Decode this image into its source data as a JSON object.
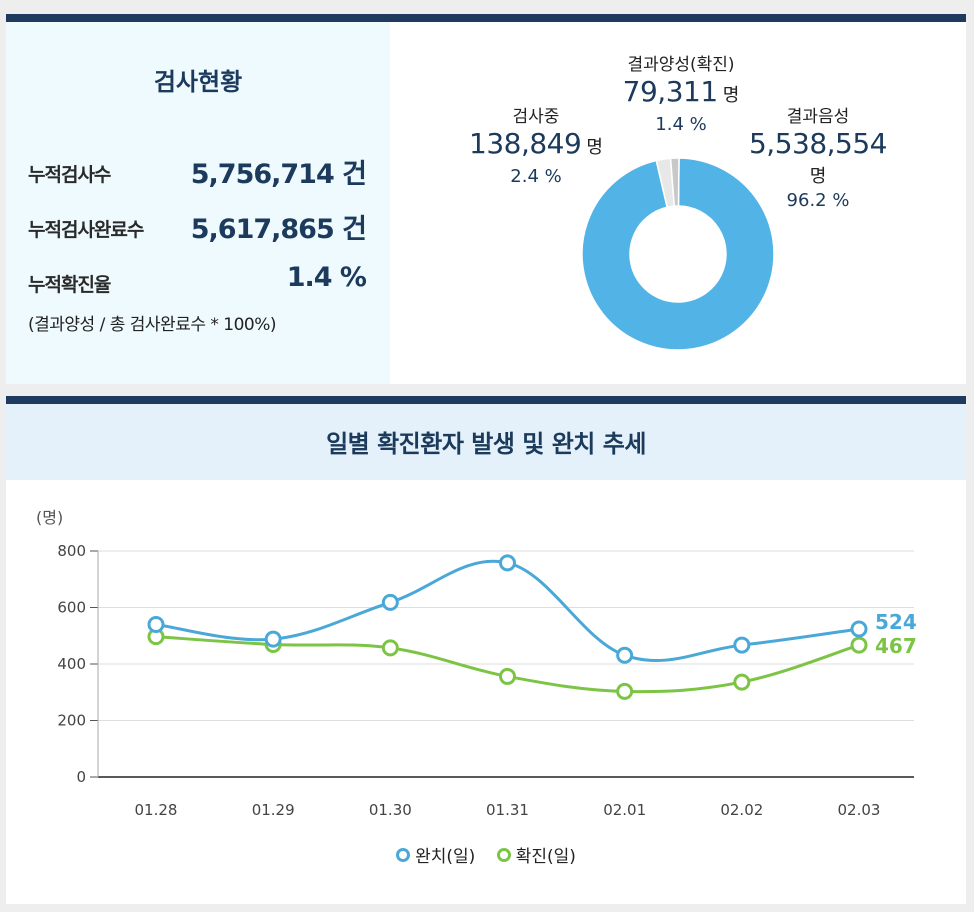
{
  "status": {
    "title": "검사현황",
    "rows": [
      {
        "label": "누적검사수",
        "value": "5,756,714 건"
      },
      {
        "label": "누적검사완료수",
        "value": "5,617,865 건"
      },
      {
        "label": "누적확진율",
        "value": "1.4 %"
      }
    ],
    "formula": "(결과양성 / 총 검사완료수 * 100%)"
  },
  "donut": {
    "labels": {
      "testing": {
        "name": "검사중",
        "count": "138,849",
        "unit": "명",
        "pct": "2.4 %"
      },
      "positive": {
        "name": "결과양성(확진)",
        "count": "79,311",
        "unit": "명",
        "pct": "1.4 %"
      },
      "negative": {
        "name": "결과음성",
        "count": "5,538,554",
        "unit": "명",
        "pct": "96.2 %"
      }
    }
  },
  "trend": {
    "title": "일별 확진환자 발생 및 완치 추세",
    "unit_label": "(명)",
    "legend": [
      {
        "label": "완치(일)",
        "color": "#4aa8d8"
      },
      {
        "label": "확진(일)",
        "color": "#7cc444"
      }
    ]
  },
  "chart_data": [
    {
      "type": "pie",
      "categories": [
        "결과음성",
        "검사중",
        "결과양성(확진)"
      ],
      "values": [
        96.2,
        2.4,
        1.4
      ],
      "colors": [
        "#52b3e6",
        "#e8e8e8",
        "#c8c8c8"
      ]
    },
    {
      "type": "line",
      "title": "일별 확진환자 발생 및 완치 추세",
      "categories": [
        "01.28",
        "01.29",
        "01.30",
        "01.31",
        "02.01",
        "02.02",
        "02.03"
      ],
      "series": [
        {
          "name": "완치(일)",
          "values": [
            540,
            488,
            618,
            758,
            431,
            467,
            524
          ],
          "color": "#4aa8d8"
        },
        {
          "name": "확진(일)",
          "values": [
            497,
            469,
            457,
            356,
            303,
            336,
            467
          ],
          "color": "#7cc444"
        }
      ],
      "ylabel": "(명)",
      "ylim": [
        0,
        800
      ],
      "yticks": [
        0,
        200,
        400,
        600,
        800
      ],
      "grid": true,
      "end_labels": [
        "524",
        "467"
      ],
      "legend_position": "bottom"
    }
  ]
}
